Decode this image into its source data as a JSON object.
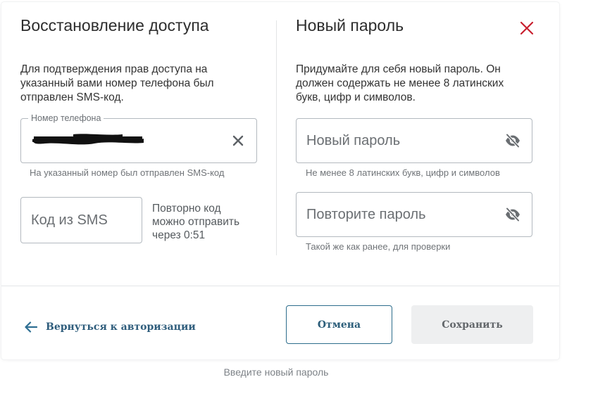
{
  "left_panel": {
    "title": "Восстановление доступа",
    "description": "Для подтверждения прав доступа на указанный вами номер телефона был отправлен SMS-код.",
    "phone_field": {
      "legend": "Номер телефона",
      "value_masked": true,
      "hint": "На указанный номер был отправлен SMS-код",
      "clear_icon": "close-icon"
    },
    "sms_field": {
      "placeholder": "Код из SMS"
    },
    "resend_text": "Повторно код можно отправить через 0:51"
  },
  "right_panel": {
    "title": "Новый пароль",
    "description": "Придумайте для себя новый пароль. Он должен содержать не менее 8 латинских букв, цифр и символов.",
    "new_password": {
      "placeholder": "Новый пароль",
      "hint": "Не менее 8 латинских букв, цифр и символов",
      "toggle_icon": "eye-off-icon"
    },
    "repeat_password": {
      "placeholder": "Повторите пароль",
      "hint": "Такой же как ранее, для проверки",
      "toggle_icon": "eye-off-icon"
    }
  },
  "close_icon": "close-icon",
  "footer": {
    "back_label": "Вернуться к авторизации",
    "cancel_label": "Отмена",
    "save_label": "Сохранить"
  },
  "caption": "Введите новый пароль",
  "colors": {
    "accent": "#2f5d7c",
    "close": "#c8202f",
    "border": "#b3b9bf",
    "disabled_bg": "#eeeff0"
  }
}
